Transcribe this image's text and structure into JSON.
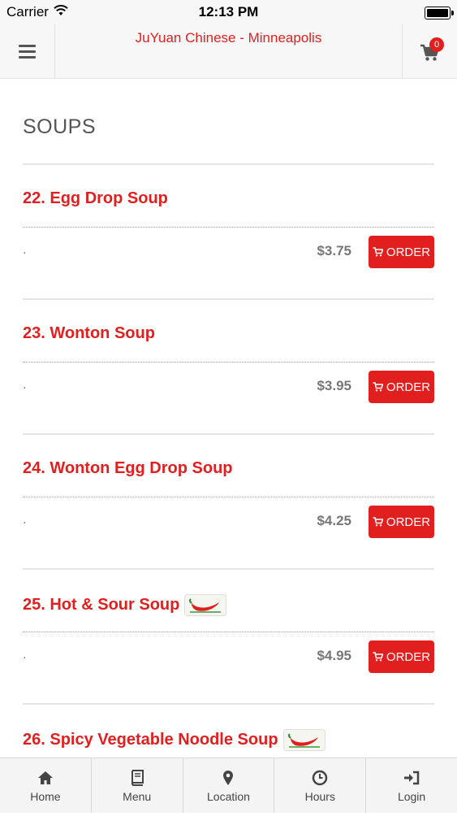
{
  "status_bar": {
    "carrier": "Carrier",
    "time": "12:13 PM"
  },
  "header": {
    "title": "JuYuan Chinese - Minneapolis",
    "cart_count": "0"
  },
  "section": {
    "title": "SOUPS"
  },
  "items": [
    {
      "name": "22. Egg Drop Soup",
      "desc": ".",
      "price": "$3.75",
      "order_label": "ORDER",
      "spicy": false
    },
    {
      "name": "23. Wonton Soup",
      "desc": ".",
      "price": "$3.95",
      "order_label": "ORDER",
      "spicy": false
    },
    {
      "name": "24. Wonton Egg Drop Soup",
      "desc": ".",
      "price": "$4.25",
      "order_label": "ORDER",
      "spicy": false
    },
    {
      "name": "25. Hot & Sour Soup",
      "desc": ".",
      "price": "$4.95",
      "order_label": "ORDER",
      "spicy": true
    },
    {
      "name": "26. Spicy Vegetable Noodle Soup",
      "spicy": true
    }
  ],
  "tabs": [
    {
      "label": "Home",
      "icon": "home-icon"
    },
    {
      "label": "Menu",
      "icon": "book-icon"
    },
    {
      "label": "Location",
      "icon": "map-pin-icon"
    },
    {
      "label": "Hours",
      "icon": "clock-icon"
    },
    {
      "label": "Login",
      "icon": "login-icon"
    }
  ],
  "colors": {
    "accent": "#e21f1f",
    "text_gray": "#777777",
    "header_bg": "#f7f7f7"
  }
}
